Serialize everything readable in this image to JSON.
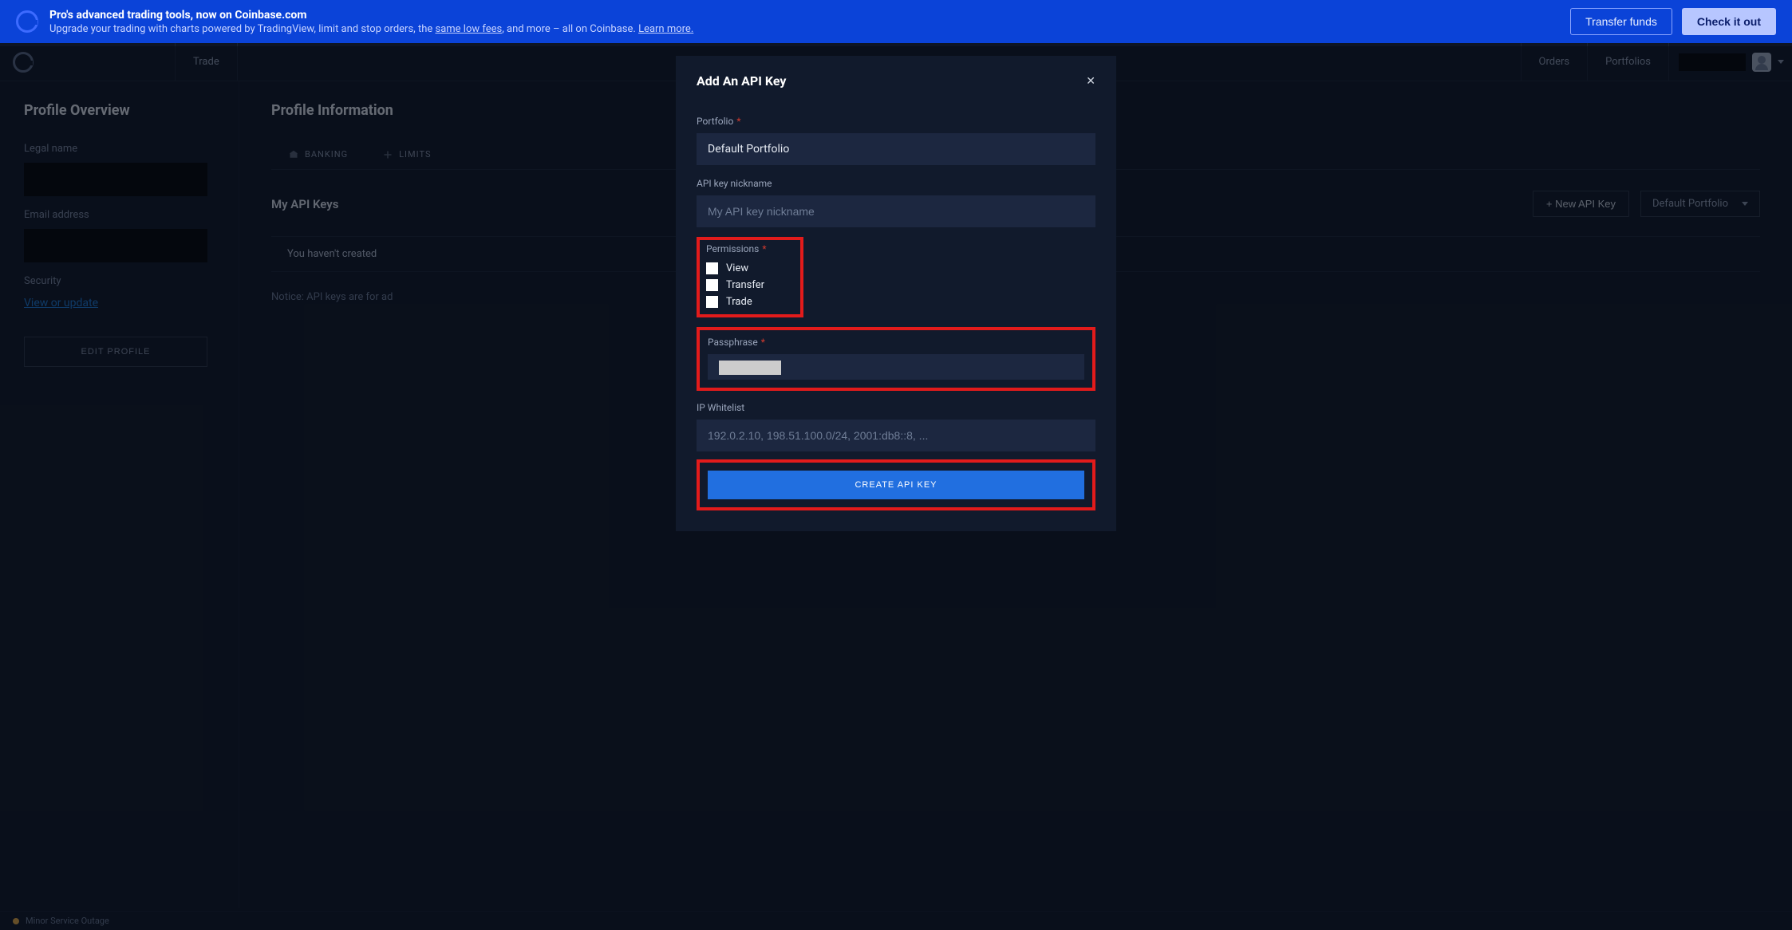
{
  "promo": {
    "title": "Pro's advanced trading tools, now on Coinbase.com",
    "sub_pre": "Upgrade your trading with charts powered by TradingView, limit and stop orders, the ",
    "sub_link1": "same low fees",
    "sub_mid": ", and more – all on Coinbase. ",
    "sub_link2": "Learn more.",
    "transfer_btn": "Transfer funds",
    "check_btn": "Check it out"
  },
  "nav": {
    "trade": "Trade",
    "orders": "Orders",
    "portfolios": "Portfolios"
  },
  "sidebar": {
    "title": "Profile Overview",
    "legal_name_label": "Legal name",
    "email_label": "Email address",
    "security_label": "Security",
    "security_link": "View or update",
    "edit_btn": "EDIT PROFILE"
  },
  "main": {
    "title": "Profile Information",
    "tabs": {
      "banking": "BANKING",
      "limits": "LIMITS"
    },
    "section_title": "My API Keys",
    "new_key_btn": "+ New API Key",
    "portfolio_selected": "Default Portfolio",
    "empty_row": "You haven't created",
    "notice": "Notice: API keys are for ad"
  },
  "modal": {
    "title": "Add An API Key",
    "portfolio_label": "Portfolio",
    "portfolio_value": "Default Portfolio",
    "nickname_label": "API key nickname",
    "nickname_placeholder": "My API key nickname",
    "permissions_label": "Permissions",
    "perm_view": "View",
    "perm_transfer": "Transfer",
    "perm_trade": "Trade",
    "passphrase_label": "Passphrase",
    "ip_label": "IP Whitelist",
    "ip_placeholder": "192.0.2.10, 198.51.100.0/24, 2001:db8::8, ...",
    "create_btn": "CREATE API KEY"
  },
  "footer": {
    "status": "Minor Service Outage"
  }
}
